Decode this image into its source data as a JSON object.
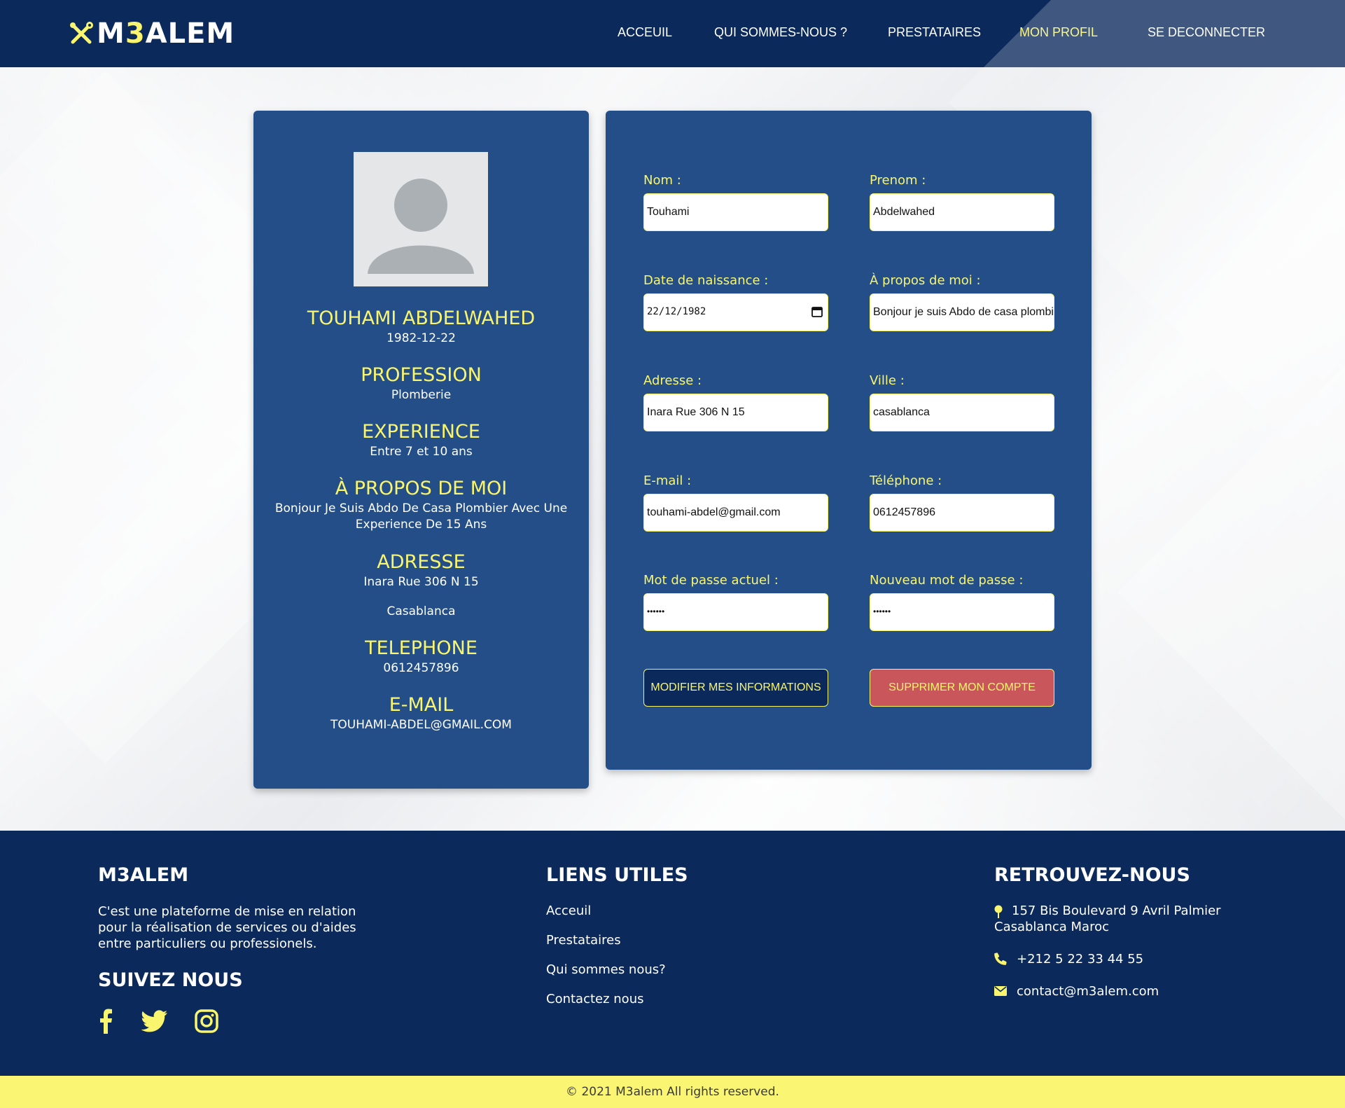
{
  "brand": {
    "logo_text_a": "M",
    "logo_text_b": "3",
    "logo_text_c": "ALEM"
  },
  "nav": {
    "home": "ACCEUIL",
    "about": "QUI SOMMES-NOUS ?",
    "providers": "PRESTATAIRES",
    "profile": "MON PROFIL",
    "logout": "SE DECONNECTER"
  },
  "profile": {
    "name": "TOUHAMI ABDELWAHED",
    "birth": "1982-12-22",
    "profession_title": "PROFESSION",
    "profession": "Plomberie",
    "experience_title": "EXPERIENCE",
    "experience": "Entre 7 et 10 ans",
    "about_title": "À PROPOS DE MOI",
    "about_line1": "Bonjour Je Suis Abdo De Casa Plombier Avec Une",
    "about_line2": "Experience De 15 Ans",
    "address_title": "ADRESSE",
    "address": "Inara Rue 306 N 15",
    "city": "Casablanca",
    "phone_title": "TELEPHONE",
    "phone": "0612457896",
    "email_title": "E-MAIL",
    "email": "TOUHAMI-ABDEL@GMAIL.COM"
  },
  "form": {
    "nom_label": "Nom :",
    "nom_value": "Touhami",
    "prenom_label": "Prenom :",
    "prenom_value": "Abdelwahed",
    "date_label": "Date de naissance :",
    "date_value": "22/12/1982",
    "about_label": "À propos de moi :",
    "about_value": "Bonjour je suis Abdo de casa plombi",
    "adresse_label": "Adresse :",
    "adresse_value": "Inara Rue 306 N 15",
    "ville_label": "Ville :",
    "ville_value": "casablanca",
    "email_label": "E-mail :",
    "email_value": "touhami-abdel@gmail.com",
    "tel_label": "Téléphone :",
    "tel_value": "0612457896",
    "pwd_label": "Mot de passe actuel :",
    "pwd_value": "••••••",
    "newpwd_label": "Nouveau mot de passe :",
    "newpwd_value": "••••••",
    "modify_button": "MODIFIER MES INFORMATIONS",
    "delete_button": "SUPPRIMER MON COMPTE"
  },
  "footer": {
    "brand_title": "M3ALEM",
    "brand_line1": "C'est une plateforme de mise en relation",
    "brand_line2": "pour la réalisation de services ou d'aides",
    "brand_line3": "entre particuliers ou professionels.",
    "follow_title": "SUIVEZ NOUS",
    "links_title": "LIENS UTILES",
    "link_home": "Acceuil",
    "link_providers": "Prestataires",
    "link_about": "Qui sommes nous?",
    "link_contact": "Contactez nous",
    "find_title": "RETROUVEZ-NOUS",
    "address_line1": "157 Bis Boulevard 9 Avril Palmier",
    "address_line2": "Casablanca Maroc",
    "phone": "+212 5 22 33 44 55",
    "email": "contact@m3alem.com",
    "copyright": "© 2021 M3alem All rights reserved."
  },
  "colors": {
    "navy": "#0b2a5b",
    "card_blue": "#234e87",
    "accent_yellow": "#f9f56e",
    "delete_red": "#c8565a"
  },
  "icons": {
    "logo": "wrench-screwdriver-icon",
    "avatar": "user-placeholder-icon",
    "date": "calendar-icon",
    "facebook": "facebook-icon",
    "twitter": "twitter-icon",
    "instagram": "instagram-icon",
    "address": "map-pin-icon",
    "phone": "phone-icon",
    "email": "envelope-icon"
  }
}
